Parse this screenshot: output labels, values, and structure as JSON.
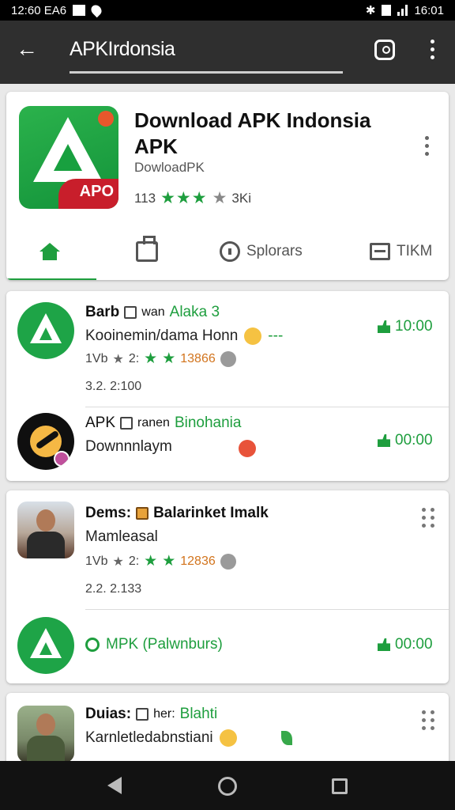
{
  "status_bar": {
    "left_text": "12:60 EA6",
    "right_text": "16:01"
  },
  "toolbar": {
    "title": "APKIrdonsia",
    "back_icon": "arrow-left-icon",
    "search_icon": "search-icon",
    "more_icon": "more-vertical-icon"
  },
  "app_header": {
    "title": "Download APK Indonsia APK",
    "developer": "DowloadPK",
    "icon_badge": "APO",
    "rating_count": "113",
    "rating_stars": "★★★",
    "rating_extra": "3Ki"
  },
  "tabs": [
    {
      "label": "",
      "icon": "home-icon",
      "active": true
    },
    {
      "label": "",
      "icon": "shopping-bag-icon",
      "active": false
    },
    {
      "label": "Splorars",
      "icon": "chat-bubble-icon",
      "active": false
    },
    {
      "label": "TIKM",
      "icon": "box-icon",
      "active": false
    }
  ],
  "feed_card_1": {
    "items": [
      {
        "author": "Barb",
        "meta_prefix": "wan",
        "tag": "Alaka 3",
        "text": "Kooinemin/dama Honn",
        "stats_prefix": "1Vb",
        "stats_mid": "2:",
        "stats_count": "13866",
        "version": "3.2. 2:100",
        "time": "10:00"
      },
      {
        "author": "APK",
        "meta_prefix": "ranen",
        "tag": "Binohania",
        "text": "Downnnlaym",
        "time": "00:00"
      }
    ]
  },
  "feed_card_2": {
    "items": [
      {
        "author": "Dems:",
        "tag": "Balarinket Imalk",
        "text": "Mamleasal",
        "stats_prefix": "1Vb",
        "stats_mid": "2:",
        "stats_count": "12836",
        "version": "2.2. 2.133"
      },
      {
        "text": "MPK (Palwnburs)",
        "time": "00:00"
      }
    ]
  },
  "feed_card_3": {
    "items": [
      {
        "author": "Duias:",
        "meta_prefix": "her:",
        "tag": "Blahti",
        "text": "Karnletledabnstiani"
      }
    ]
  },
  "colors": {
    "accent": "#1e9e3e",
    "toolbar": "#2f2f2f",
    "status": "#000000",
    "badge_red": "#c81e2b"
  }
}
